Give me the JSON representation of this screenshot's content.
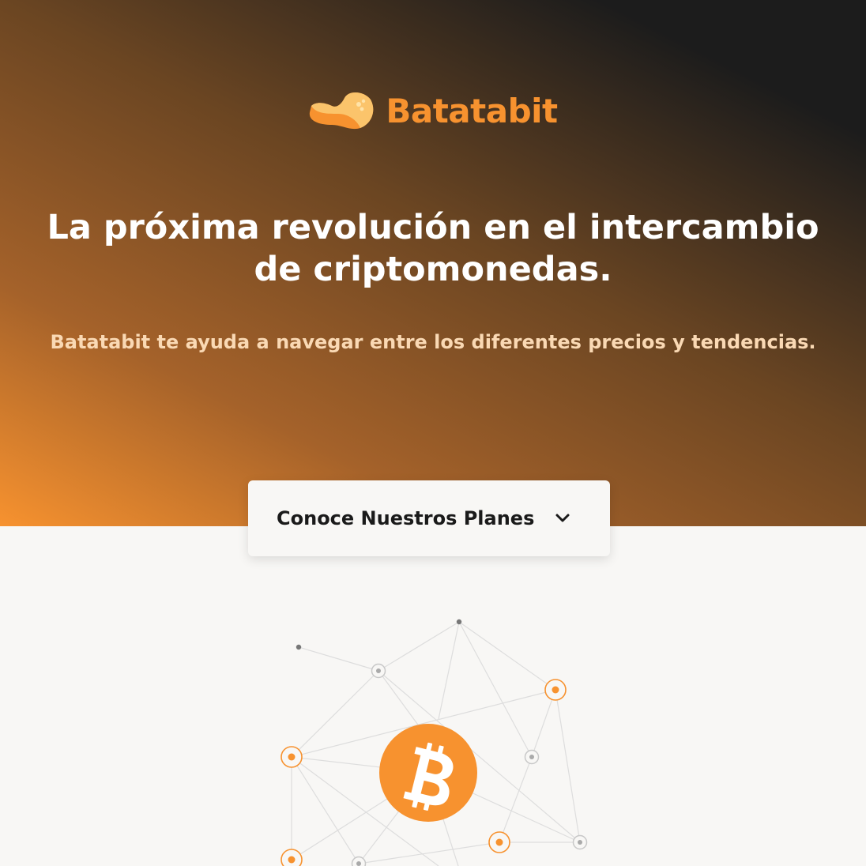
{
  "brand": {
    "name": "Batatabit",
    "color": "#f7922f",
    "icon": "potato-logo-icon"
  },
  "hero": {
    "title": "La próxima revolución en el intercambio de criptomonedas.",
    "subtitle": "Batatabit te ayuda a navegar entre los diferentes precios y tendencias.",
    "gradient": [
      "#1c1c1c",
      "#6a4522",
      "#f7922f"
    ]
  },
  "plans_button": {
    "label": "Conoce Nuestros Planes",
    "icon": "chevron-down-icon"
  },
  "illustration": {
    "icon": "bitcoin-icon",
    "node_color": "#f7922f",
    "neutral_node_color": "#aaaaaa"
  }
}
